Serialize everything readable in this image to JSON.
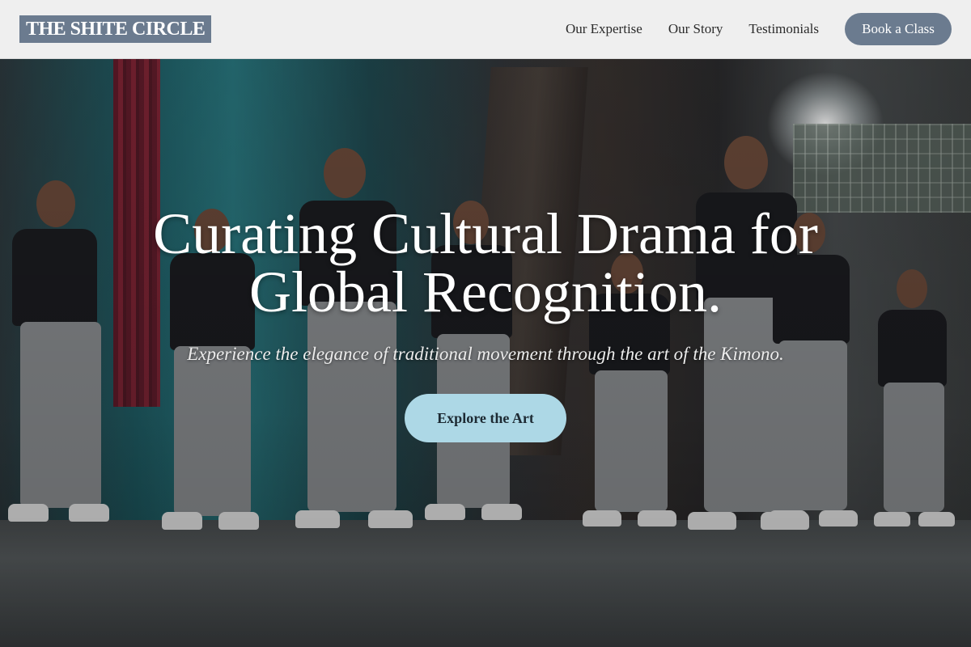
{
  "header": {
    "logo_text": "THE SHITE CIRCLE",
    "nav": [
      {
        "label": "Our Expertise"
      },
      {
        "label": "Our Story"
      },
      {
        "label": "Testimonials"
      }
    ],
    "cta_label": "Book a Class"
  },
  "hero": {
    "title_line1": "Curating Cultural Drama for",
    "title_line2": "Global Recognition.",
    "subtitle": "Experience the elegance of traditional movement through the art of the Kimono.",
    "button_label": "Explore the Art",
    "background_image": "stage-dance-troupe-photo"
  },
  "colors": {
    "accent": "#6b7b8f",
    "button_light": "#add8e6",
    "header_bg": "#efefef"
  }
}
